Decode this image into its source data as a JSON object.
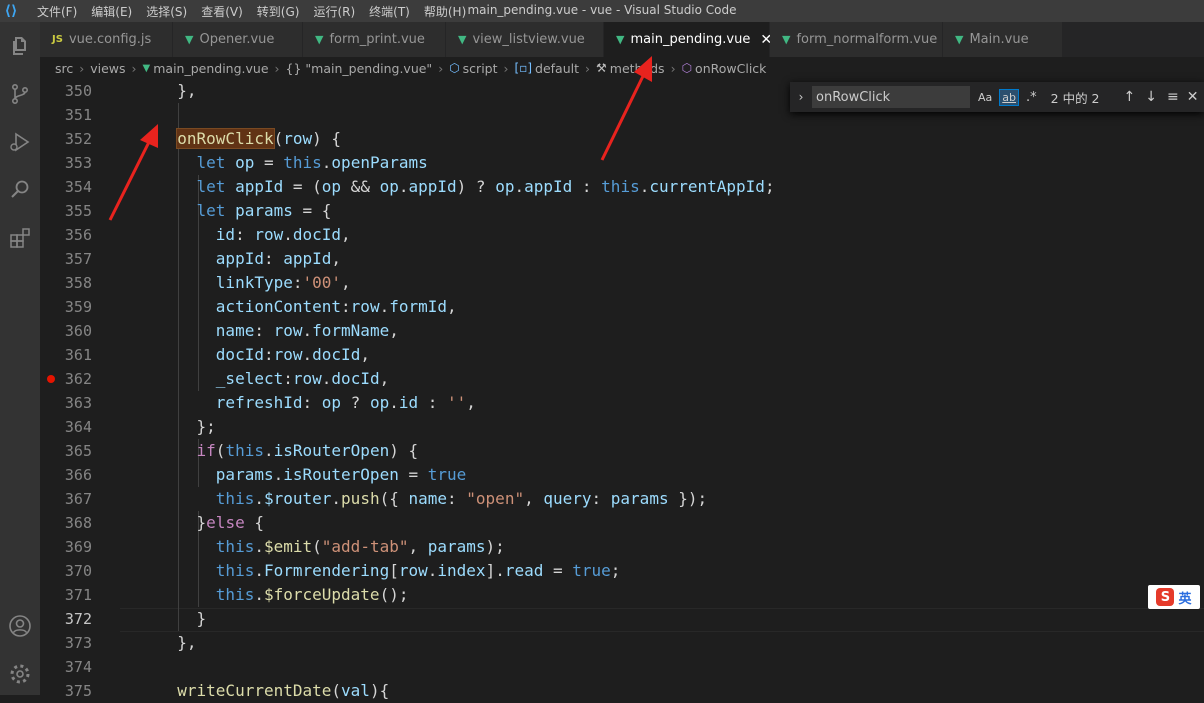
{
  "titlebar": {
    "menu": [
      "文件(F)",
      "编辑(E)",
      "选择(S)",
      "查看(V)",
      "转到(G)",
      "运行(R)",
      "终端(T)",
      "帮助(H)"
    ],
    "title": "main_pending.vue - vue - Visual Studio Code"
  },
  "tabs": [
    {
      "label": "vue.config.js",
      "icon": "js"
    },
    {
      "label": "Opener.vue",
      "icon": "vue"
    },
    {
      "label": "form_print.vue",
      "icon": "vue"
    },
    {
      "label": "view_listview.vue",
      "icon": "vue"
    },
    {
      "label": "main_pending.vue",
      "icon": "vue",
      "active": true
    },
    {
      "label": "form_normalform.vue",
      "icon": "vue"
    },
    {
      "label": "Main.vue",
      "icon": "vue"
    }
  ],
  "breadcrumb": [
    "src",
    "views",
    "main_pending.vue",
    "{} \"main_pending.vue\"",
    "script",
    "default",
    "methods",
    "onRowClick"
  ],
  "find": {
    "value": "onRowClick",
    "opt_case": "Aa",
    "opt_word": "ab",
    "opt_regex": ".*",
    "count": "2 中的 2"
  },
  "editor": {
    "lines": [
      350,
      351,
      352,
      353,
      354,
      355,
      356,
      357,
      358,
      359,
      360,
      361,
      362,
      363,
      364,
      365,
      366,
      367,
      368,
      369,
      370,
      371,
      372,
      373,
      374,
      375
    ],
    "current_line": 372,
    "breakpoint_line": 362
  },
  "ime": {
    "label": "英"
  },
  "colors": {
    "accent": "#007acc",
    "vue_green": "#41b883",
    "breakpoint": "#e51400",
    "arrow": "#e8231e"
  }
}
